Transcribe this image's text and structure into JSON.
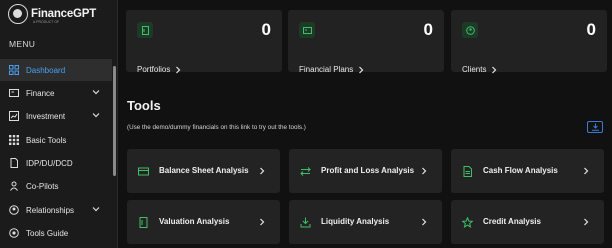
{
  "brand": {
    "name": "FinanceGPT",
    "tagline": "A PRODUCT OF"
  },
  "sidebar": {
    "menu_label": "MENU",
    "items": [
      {
        "label": "Dashboard",
        "icon": "dashboard-icon",
        "active": true,
        "chevron": false
      },
      {
        "label": "Finance",
        "icon": "finance-icon",
        "active": false,
        "chevron": true
      },
      {
        "label": "Investment",
        "icon": "investment-icon",
        "active": false,
        "chevron": true
      },
      {
        "label": "Basic Tools",
        "icon": "grid-icon",
        "active": false,
        "chevron": false
      },
      {
        "label": "IDP/DU/DCD",
        "icon": "document-icon",
        "active": false,
        "chevron": false
      },
      {
        "label": "Co-Pilots",
        "icon": "copilot-icon",
        "active": false,
        "chevron": false
      },
      {
        "label": "Relationships",
        "icon": "relationships-icon",
        "active": false,
        "chevron": true
      },
      {
        "label": "Tools Guide",
        "icon": "guide-icon",
        "active": false,
        "chevron": false
      }
    ]
  },
  "stats": [
    {
      "label": "Portfolios",
      "value": "0",
      "icon": "portfolio-icon"
    },
    {
      "label": "Financial Plans",
      "value": "0",
      "icon": "plan-icon"
    },
    {
      "label": "Clients",
      "value": "0",
      "icon": "clients-icon"
    }
  ],
  "tools": {
    "title": "Tools",
    "note": "(Use the demo/dummy financials on this link to try out the tools.)",
    "items": [
      {
        "label": "Balance Sheet Analysis",
        "icon": "card-icon"
      },
      {
        "label": "Profit and Loss Analysis",
        "icon": "exchange-icon"
      },
      {
        "label": "Cash Flow Analysis",
        "icon": "file-icon"
      },
      {
        "label": "Valuation Analysis",
        "icon": "document-icon"
      },
      {
        "label": "Liquidity Analysis",
        "icon": "download-icon"
      },
      {
        "label": "Credit Analysis",
        "icon": "star-icon"
      }
    ]
  },
  "colors": {
    "accent": "#4a9ff5",
    "background": "#111111",
    "card": "#232323",
    "green_icon": "#3fbf6a"
  }
}
